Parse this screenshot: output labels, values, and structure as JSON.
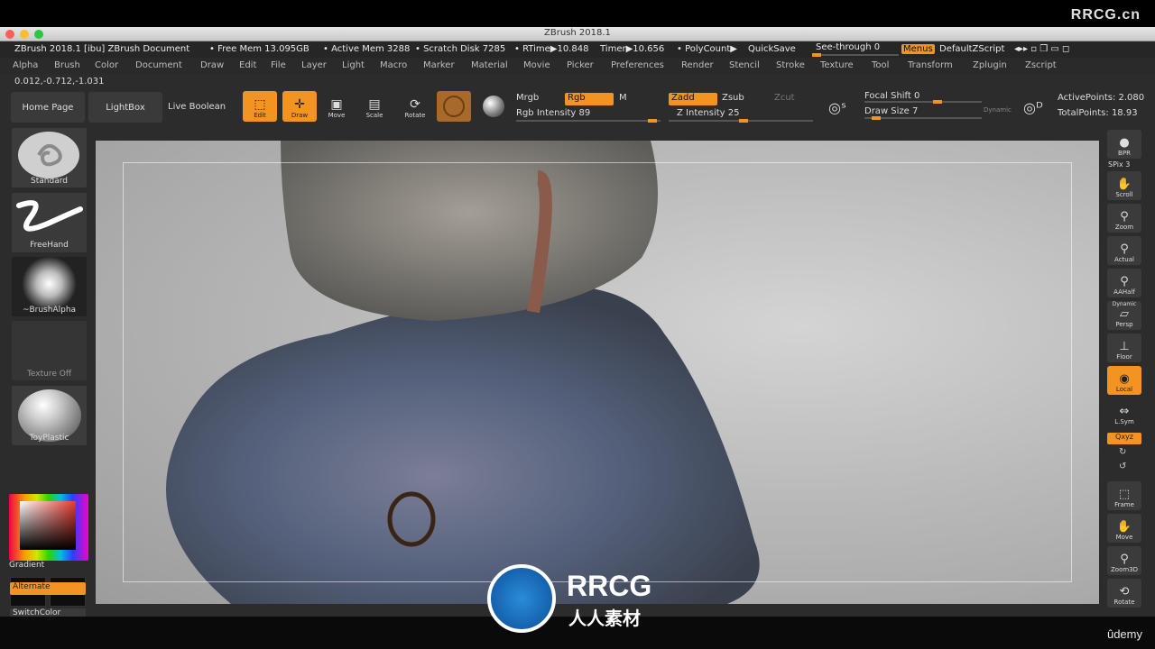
{
  "window": {
    "title": "ZBrush 2018.1",
    "watermark": "RRCG.cn"
  },
  "status": {
    "doc": "ZBrush 2018.1 [ibu] ZBrush Document",
    "free_mem": "• Free Mem 13.095GB",
    "active_mem": "• Active Mem 3288",
    "scratch": "• Scratch Disk 7285",
    "rtime": "• RTime▶10.848",
    "timer": "Timer▶10.656",
    "polycount": "• PolyCount▶",
    "quicksave": "QuickSave",
    "seethrough": "See-through  0",
    "menus": "Menus",
    "defaultzscript": "DefaultZScript"
  },
  "menu": [
    "Alpha",
    "Brush",
    "Color",
    "Document",
    "Draw",
    "Edit",
    "File",
    "Layer",
    "Light",
    "Macro",
    "Marker",
    "Material",
    "Movie",
    "Picker",
    "Preferences",
    "Render",
    "Stencil",
    "Stroke",
    "Texture",
    "Tool",
    "Transform",
    "Zplugin",
    "Zscript"
  ],
  "coords": "0.012,-0.712,-1.031",
  "shelf": {
    "home": "Home Page",
    "lightbox": "LightBox",
    "liveboolean": "Live Boolean",
    "edit": "Edit",
    "draw": "Draw",
    "move": "Move",
    "scale": "Scale",
    "rotate": "Rotate",
    "mrgb": "Mrgb",
    "rgb": "Rgb",
    "m": "M",
    "rgb_intensity": "Rgb Intensity 89",
    "zadd": "Zadd",
    "zsub": "Zsub",
    "zcut": "Zcut",
    "z_intensity": "Z Intensity 25",
    "focal_shift": "Focal Shift 0",
    "draw_size": "Draw Size 7",
    "dynamic": "Dynamic",
    "active_points": "ActivePoints: 2.080",
    "total_points": "TotalPoints: 18.93"
  },
  "left": {
    "brush": "Standard",
    "stroke": "FreeHand",
    "alpha": "~BrushAlpha",
    "texture": "Texture Off",
    "material": "ToyPlastic",
    "gradient": "Gradient",
    "switchcolor": "SwitchColor",
    "alternate": "Alternate"
  },
  "right": {
    "bpr": "BPR",
    "spix": "SPix 3",
    "scroll": "Scroll",
    "zoom": "Zoom",
    "actual": "Actual",
    "aahalf": "AAHalf",
    "dynamic": "Dynamic",
    "persp": "Persp",
    "floor": "Floor",
    "local": "Local",
    "lsym": "L.Sym",
    "xyz": "Qxyz",
    "frame": "Frame",
    "move": "Move",
    "zoom3d": "Zoom3D",
    "rotate": "Rotate"
  },
  "logo": {
    "main": "RRCG",
    "sub": "人人素材"
  },
  "footer": {
    "udemy": "ûdemy"
  },
  "colors": {
    "accent": "#f29322"
  }
}
